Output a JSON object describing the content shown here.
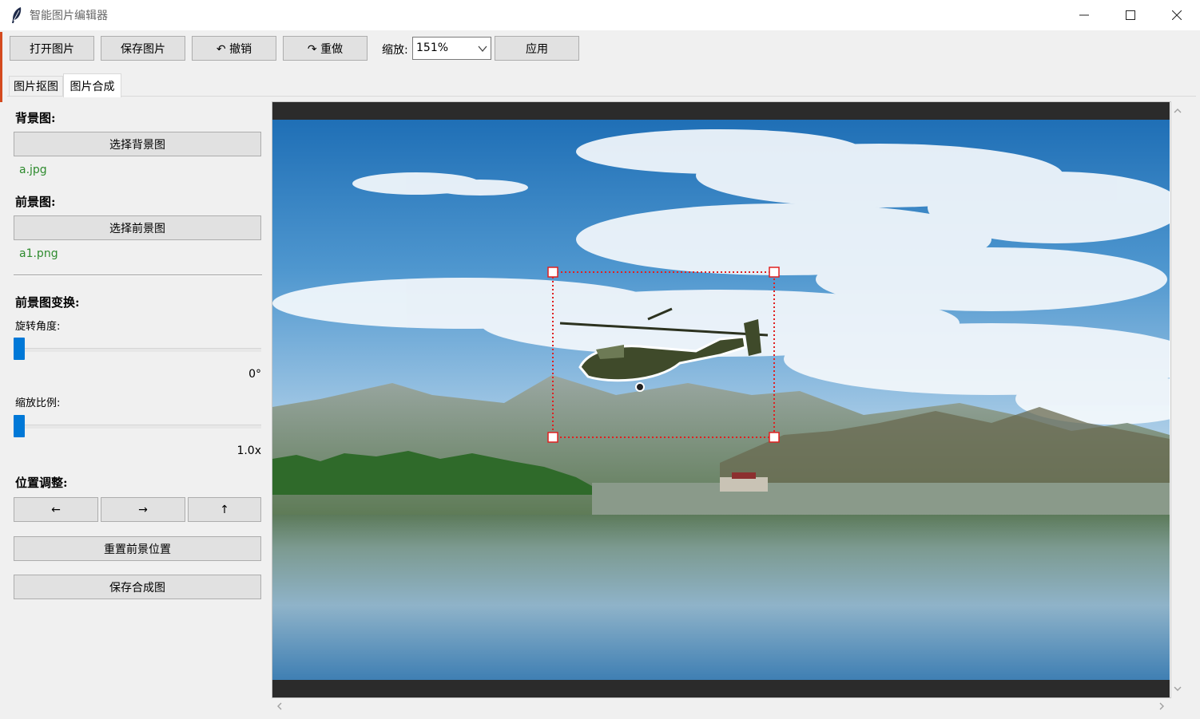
{
  "window": {
    "title": "智能图片编辑器",
    "controls": {
      "minimize": "─",
      "maximize": "☐",
      "close": "✕"
    }
  },
  "toolbar": {
    "open_label": "打开图片",
    "save_label": "保存图片",
    "undo_label": "↶ 撤销",
    "redo_label": "↷ 重做",
    "zoom_label": "缩放:",
    "zoom_value": "151%",
    "apply_label": "应用"
  },
  "tabs": [
    {
      "label": "图片抠图",
      "active": false
    },
    {
      "label": "图片合成",
      "active": true
    }
  ],
  "panel": {
    "background_title": "背景图:",
    "select_background": "选择背景图",
    "background_file": "a.jpg",
    "foreground_title": "前景图:",
    "select_foreground": "选择前景图",
    "foreground_file": "a1.png",
    "transform_title": "前景图变换:",
    "rotation_label": "旋转角度:",
    "rotation_value": "0°",
    "rotation_level": 0.0,
    "scale_label": "缩放比例:",
    "scale_value": "1.0x",
    "scale_level": 0.0,
    "position_title": "位置调整:",
    "move_left": "←",
    "move_right": "→",
    "move_up": "↑",
    "reset_position": "重置前景位置",
    "save_composite": "保存合成图"
  },
  "colors": {
    "accent": "#0078d7",
    "file_text": "#2e8b2e",
    "selection": "#e02020",
    "canvas_band": "#2b2b2b"
  },
  "icons": {
    "app": "feather-icon",
    "dropdown": "chevron-down-icon",
    "scroll_up": "chevron-up-icon",
    "scroll_down": "chevron-down-icon",
    "scroll_left": "chevron-left-icon",
    "scroll_right": "chevron-right-icon"
  }
}
